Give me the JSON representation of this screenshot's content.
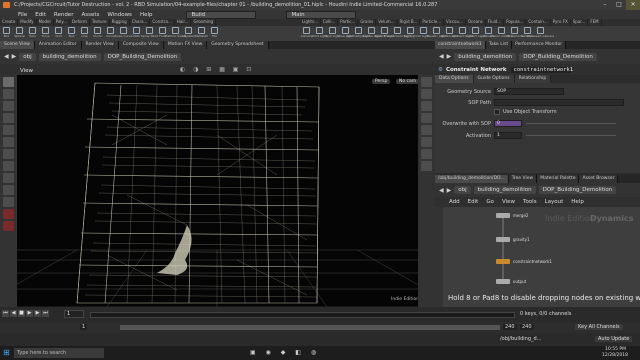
{
  "window": {
    "title": "C:/Projects/CGCircuit/Tutor Destruction - vol. 2 - RBD Simulation/04-example-files/chapter 01 - /building_demolition_01.hiplc - Houdini Indie Limited-Commercial 16.0.287"
  },
  "menu": {
    "items": [
      "File",
      "Edit",
      "Render",
      "Assets",
      "Windows",
      "Help"
    ],
    "build": "Build",
    "main": "Main"
  },
  "shelf_tabs": [
    "Create",
    "Modify",
    "Model",
    "Poly...",
    "Deform",
    "Texture",
    "Rigging",
    "Chara...",
    "Constra...",
    "Hair...",
    "Grooming"
  ],
  "shelf_tabs2": [
    "Lights...",
    "Colli...",
    "Partic...",
    "Grains",
    "Velum...",
    "Rigid B...",
    "Particle...",
    "Viscou...",
    "Oceans",
    "Fluid...",
    "Popula...",
    "Contain...",
    "Pyro FX",
    "Spar...",
    "FEM"
  ],
  "shelf_tools": [
    "Box",
    "Sphere",
    "Tube",
    "Torus",
    "Grid",
    "Null",
    "Line",
    "Circle",
    "Curve",
    "Draw Curve",
    "Path",
    "Spray Paint",
    "Font",
    "Platonic Solids",
    "L-System",
    "Metaball",
    "File"
  ],
  "shelf_tools2": [
    "Camera",
    "Point Light",
    "Spot Light",
    "Area Light",
    "Geometry Light",
    "Volume Light",
    "Distant Light",
    "Environment Light",
    "Sky Light",
    "GI Light",
    "Caustic Light",
    "Portal Light",
    "Ambient Light",
    "Indirect Light",
    "Camera",
    "Stereo Camera",
    "VR Camera",
    "Switcher",
    "Gamepad Camera"
  ],
  "pane_tabs": [
    "Scene View",
    "Animation Editor",
    "Render View",
    "Composite View",
    "Motion FX View",
    "Geometry Spreadsheet"
  ],
  "breadcrumbs": {
    "obj": "obj",
    "node": "building_demolition",
    "dop": "DOP_Building_Demolition"
  },
  "viewport": {
    "label": "View",
    "persp": "Persp",
    "nocam": "No cam",
    "edition": "Indie Edition"
  },
  "right_pane_tabs": [
    "constraintnetwork1",
    "Take List",
    "Performance Monitor"
  ],
  "param_header": {
    "type": "Constraint Network",
    "name": "constraintnetwork1"
  },
  "param_tabs": [
    "Data Options",
    "Guide Options",
    "Relationship"
  ],
  "params": {
    "geometry_source_label": "Geometry Source",
    "geometry_source_value": "SOP",
    "sop_path_label": "SOP Path",
    "use_object_transform": "Use Object Transform",
    "overwrite_label": "Overwrite with SOP",
    "overwrite_value": "0",
    "activation_label": "Activation",
    "activation_value": "1"
  },
  "net_pane_tabs": [
    "/obj/building_demolition/DO...",
    "Tree View",
    "Material Palette",
    "Asset Browser"
  ],
  "net_menu": [
    "Add",
    "Edit",
    "Go",
    "View",
    "Tools",
    "Layout",
    "Help"
  ],
  "network": {
    "watermark_edition": "Indie Edition",
    "watermark_context": "Dynamics",
    "nodes": [
      "merge2",
      "gravity1",
      "constraintnetwork1",
      "output"
    ],
    "hint": "Hold 8 or Pad8 to disable dropping nodes on existing wires."
  },
  "timeline": {
    "frame": "1",
    "start": "1",
    "end": "240",
    "end2": "240",
    "keys": "0 keys, 0/0 channels",
    "keyall": "Key All Channels",
    "autoupdate": "Auto Update"
  },
  "status": {
    "path": "/obj/building_d..."
  },
  "taskbar": {
    "search": "Type here to search",
    "time": "10:55 PM",
    "date": "12/28/2018"
  }
}
